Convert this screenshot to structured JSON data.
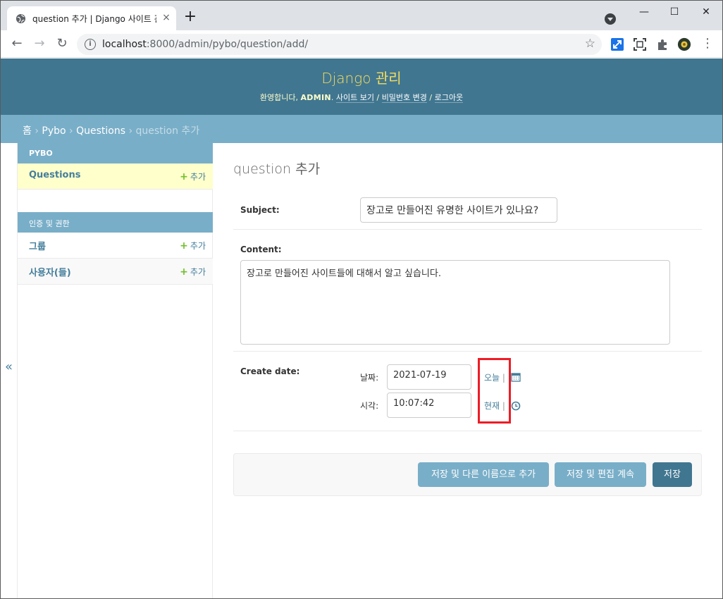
{
  "browser": {
    "tab_title": "question 추가 | Django 사이트 관리",
    "tab_close": "×",
    "new_tab": "+",
    "url_host": "localhost",
    "url_rest": ":8000/admin/pybo/question/add/",
    "window_min": "—",
    "window_max": "☐",
    "window_close": "✕",
    "back": "←",
    "forward": "→",
    "reload": "↻",
    "star": "☆",
    "menu": "⋮",
    "info": "i"
  },
  "header": {
    "branding": "Django 관리",
    "welcome": "환영합니다, ",
    "username": "ADMIN",
    "period": ". ",
    "view_site": "사이트 보기",
    "sep1": " / ",
    "change_password": "비밀번호 변경",
    "sep2": " / ",
    "logout": "로그아웃"
  },
  "breadcrumbs": {
    "home": "홈",
    "sep": " › ",
    "app": "Pybo",
    "model": "Questions",
    "current": "question 추가"
  },
  "sidebar": {
    "toggle": "«",
    "modules": [
      {
        "caption": "PYBO",
        "rows": [
          {
            "name": "Questions",
            "add": "추가"
          }
        ]
      },
      {
        "caption": "인증 및 권한",
        "rows": [
          {
            "name": "그룹",
            "add": "추가"
          },
          {
            "name": "사용자(들)",
            "add": "추가"
          }
        ]
      }
    ],
    "plus": "+"
  },
  "form": {
    "title": "question 추가",
    "subject_label": "Subject:",
    "subject_value": "장고로 만들어진 유명한 사이트가 있나요?",
    "content_label": "Content:",
    "content_value": "장고로 만들어진 사이트들에 대해서 알고 싶습니다.",
    "create_date_label": "Create date:",
    "date_label": "날짜:",
    "date_value": "2021-07-19",
    "today": "오늘",
    "time_label": "시각:",
    "time_value": "10:07:42",
    "now": "현재",
    "pipe": " |"
  },
  "buttons": {
    "save_add_another": "저장 및 다른 이름으로 추가",
    "save_continue": "저장 및 편집 계속",
    "save": "저장"
  },
  "colors": {
    "header_bg": "#417690",
    "breadcrumb_bg": "#79aec8",
    "branding": "#f5dd5d",
    "link": "#447e9b",
    "selected_row": "#ffffcc",
    "add_plus": "#70bf2b",
    "highlight": "#ee1c25"
  }
}
